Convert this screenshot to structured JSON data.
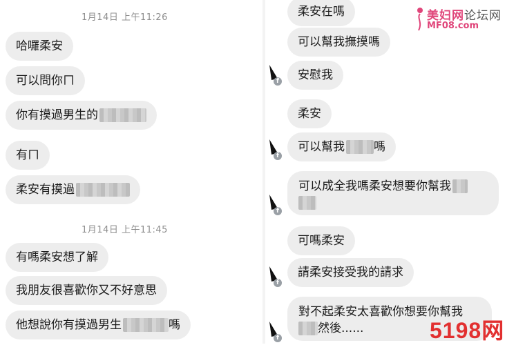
{
  "left_panel": {
    "timestamp_1": "1月14日 上午11:26",
    "timestamp_2": "1月14日 上午11:45",
    "messages": [
      "哈囉柔安",
      "可以問你ㄇ",
      "你有摸過男生的",
      "有ㄇ",
      "柔安有摸過",
      "有嗎柔安想了解",
      "我朋友很喜歡你又不好意思",
      "他想說你有摸過男生",
      "嗎"
    ]
  },
  "right_panel": {
    "messages": [
      "柔安在嗎",
      "可以幫我撫摸嗎",
      "安慰我",
      "柔安",
      "可以幫我",
      "嗎",
      "可以成全我嗎柔安想要你幫我",
      "可嗎柔安",
      "請柔安接受我的請求",
      "對不起柔安太喜歡你想要你幫我",
      "然後......"
    ]
  },
  "watermark_top": {
    "line1": "美妇网",
    "line1_suffix": "论坛网",
    "line2": "MF08.com",
    "color": "#e0457a"
  },
  "watermark_bottom": {
    "text": "5198网",
    "color": "#e23030"
  },
  "colors": {
    "bubble": "#ededed",
    "timestamp": "#8d8d8d"
  },
  "icons": {
    "avatar": "avatar-icon",
    "facebook": "facebook-badge-icon"
  }
}
